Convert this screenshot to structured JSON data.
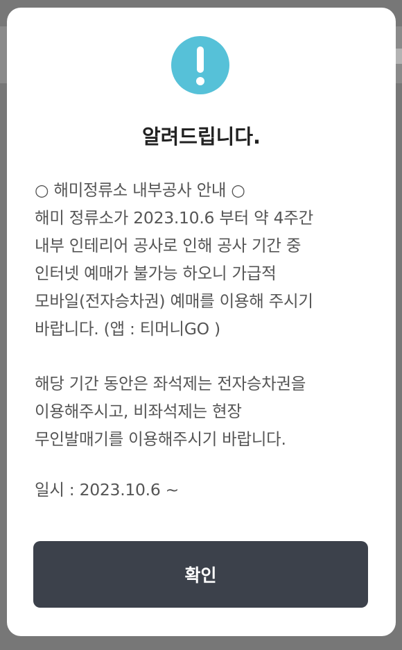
{
  "dialog": {
    "icon": "exclamation-icon",
    "accent_color": "#56c1d8",
    "title": "알려드립니다.",
    "paragraph1": [
      "○ 해미정류소 내부공사 안내 ○",
      "해미 정류소가 2023.10.6 부터 약 4주간",
      "내부 인테리어 공사로 인해 공사 기간 중",
      "인터넷 예매가 불가능 하오니 가급적",
      "모바일(전자승차권) 예매를 이용해 주시기",
      "바랍니다. (앱 : 티머니GO )"
    ],
    "paragraph2": [
      "해당 기간 동안은 좌석제는 전자승차권을",
      "이용해주시고, 비좌석제는 현장",
      "무인발매기를 이용해주시기 바랍니다."
    ],
    "schedule": "일시 :  2023.10.6 ~",
    "confirm_label": "확인",
    "confirm_color": "#3c414b"
  }
}
